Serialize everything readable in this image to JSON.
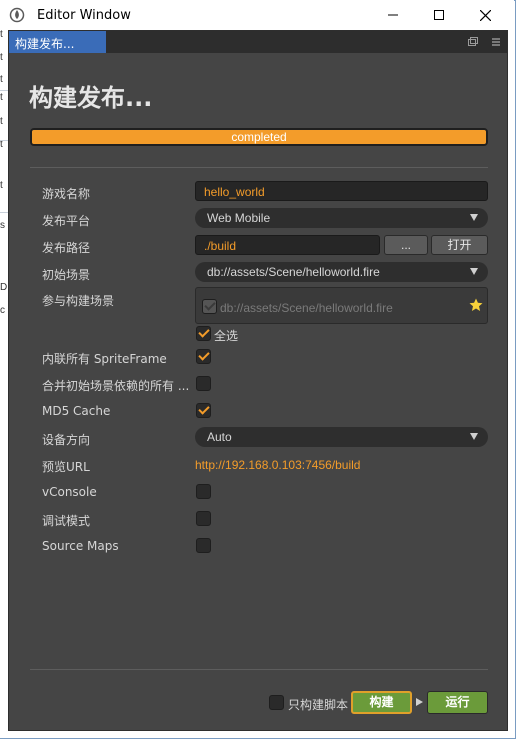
{
  "window": {
    "title": "Editor Window"
  },
  "tab": {
    "label": "构建发布..."
  },
  "heading": "构建发布...",
  "progress": {
    "text": "completed",
    "fraction": 1.0
  },
  "form": {
    "game_name": {
      "label": "游戏名称",
      "value": "hello_world"
    },
    "platform": {
      "label": "发布平台",
      "value": "Web Mobile"
    },
    "build_path": {
      "label": "发布路径",
      "value": "./build",
      "browse": "...",
      "open": "打开"
    },
    "start_scene": {
      "label": "初始场景",
      "value": "db://assets/Scene/helloworld.fire"
    },
    "scenes": {
      "label": "参与构建场景",
      "item": "db://assets/Scene/helloworld.fire",
      "select_all": "全选",
      "select_all_checked": true
    },
    "inline_spriteframe": {
      "label": "内联所有 SpriteFrame",
      "checked": true
    },
    "merge_deps": {
      "label": "合并初始场景依赖的所有 ...",
      "checked": false
    },
    "md5_cache": {
      "label": "MD5 Cache",
      "checked": true
    },
    "orientation": {
      "label": "设备方向",
      "value": "Auto"
    },
    "preview_url": {
      "label": "预览URL",
      "value": "http://192.168.0.103:7456/build"
    },
    "vconsole": {
      "label": "vConsole",
      "checked": false
    },
    "debug": {
      "label": "调试模式",
      "checked": false
    },
    "source_maps": {
      "label": "Source Maps",
      "checked": false
    }
  },
  "footer": {
    "build_script_only": {
      "label": "只构建脚本",
      "checked": false
    },
    "build_button": "构建",
    "run_button": "运行"
  },
  "colors": {
    "accent": "#f39c2a",
    "panel": "#454545",
    "tab_active": "#3a6cb8",
    "button_green": "#6b9b3a"
  },
  "left_strip_fragments": [
    "t",
    "t",
    "t",
    "t",
    "t",
    "t",
    "t",
    "s",
    "D",
    "c"
  ]
}
